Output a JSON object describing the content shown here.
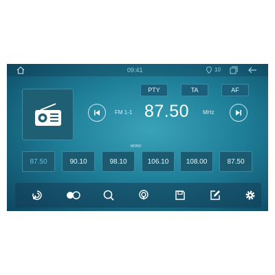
{
  "status_bar": {
    "time": "09:41",
    "volume": "10",
    "icons": [
      "home-icon",
      "gps-icon",
      "windows-icon",
      "back-arrow-icon"
    ]
  },
  "radio": {
    "tile_icon": "radio-icon",
    "band_label": "FM 1-1",
    "frequency": "87.50",
    "unit": "MHz",
    "mode": "MONO",
    "buttons": {
      "pty": "PTY",
      "ta": "TA",
      "af": "AF"
    },
    "seek_icons": [
      "seek-previous-icon",
      "seek-next-icon"
    ]
  },
  "presets": [
    {
      "label": "87.50",
      "active": true
    },
    {
      "label": "90.10"
    },
    {
      "label": "98.10"
    },
    {
      "label": "106.10"
    },
    {
      "label": "108.00"
    },
    {
      "label": "87.50"
    }
  ],
  "bottom_bar_icons": [
    "scan-icon",
    "toggle-icon",
    "search-icon",
    "broadcast-icon",
    "save-icon",
    "edit-icon",
    "settings-icon"
  ],
  "colors": {
    "accent": "#5fc4ef",
    "text": "#ffffff"
  }
}
